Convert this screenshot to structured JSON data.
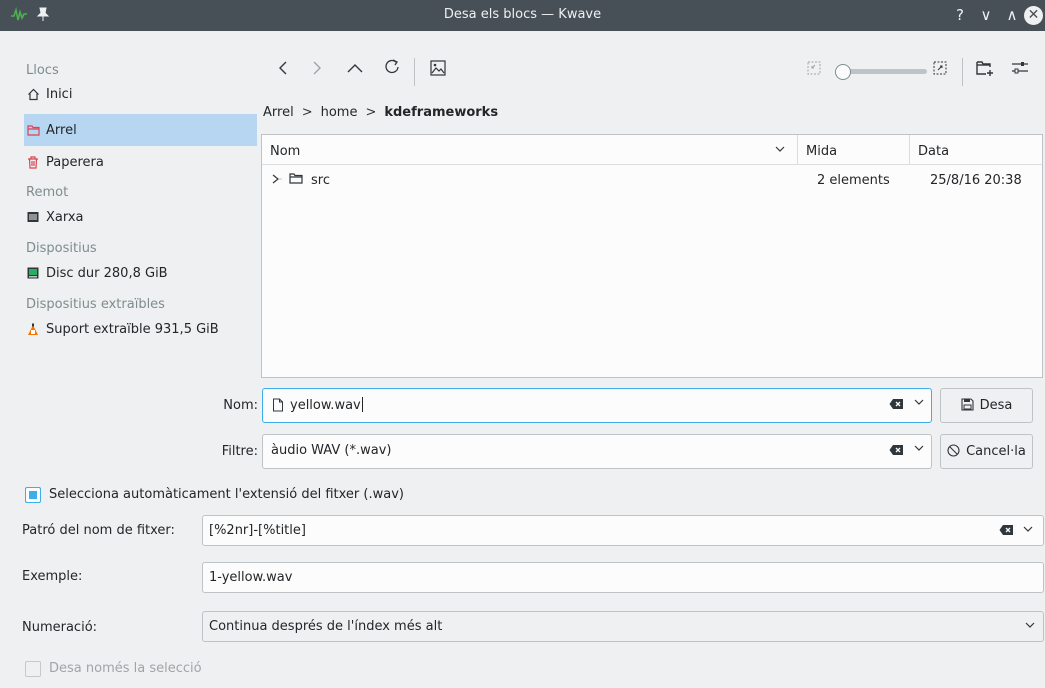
{
  "window": {
    "title": "Desa els blocs — Kwave",
    "help_glyph": "?",
    "min_glyph": "∨",
    "max_glyph": "∧",
    "close_glyph": "✕"
  },
  "places": {
    "headers": {
      "llocs": "Llocs",
      "remot": "Remot",
      "dispositius": "Dispositius",
      "extraibles": "Dispositius extraïbles"
    },
    "items": {
      "inici": "Inici",
      "arrel": "Arrel",
      "paperera": "Paperera",
      "xarxa": "Xarxa",
      "disc": "Disc dur 280,8 GiB",
      "suport": "Suport extraïble 931,5 GiB"
    }
  },
  "toolbar": {
    "back": "‹",
    "forward": "›",
    "up": "^",
    "reload": "↻",
    "preview": "▣",
    "zoom_level": 0
  },
  "breadcrumb": {
    "root": "Arrel",
    "home": "home",
    "current": "kdeframeworks",
    "sep": ">"
  },
  "fileview": {
    "columns": {
      "nom": "Nom",
      "mida": "Mida",
      "data": "Data"
    },
    "rows": [
      {
        "name": "src",
        "size": "2 elements",
        "date": "25/8/16 20:38"
      }
    ]
  },
  "form": {
    "nom_label": "Nom:",
    "nom_value": "yellow.wav",
    "filtre_label": "Filtre:",
    "filtre_value": "àudio WAV (*.wav)",
    "desa_label": "Desa",
    "cancel_label": "Cancel·la",
    "auto_ext_label": "Selecciona automàticament l'extensió del fitxer (.wav)",
    "auto_ext_checked": true,
    "pattern_label": "Patró del nom de fitxer:",
    "pattern_value": "[%2nr]-[%title]",
    "example_label": "Exemple:",
    "example_value": "1-yellow.wav",
    "numbering_label": "Numeració:",
    "numbering_value": "Continua després de l'índex més alt",
    "selection_only_label": "Desa només la selecció",
    "selection_only_checked": false
  },
  "colors": {
    "titlebar": "#475057",
    "selection": "#b6d6f2",
    "focus": "#3daee9",
    "window_bg": "#eff0f1"
  }
}
